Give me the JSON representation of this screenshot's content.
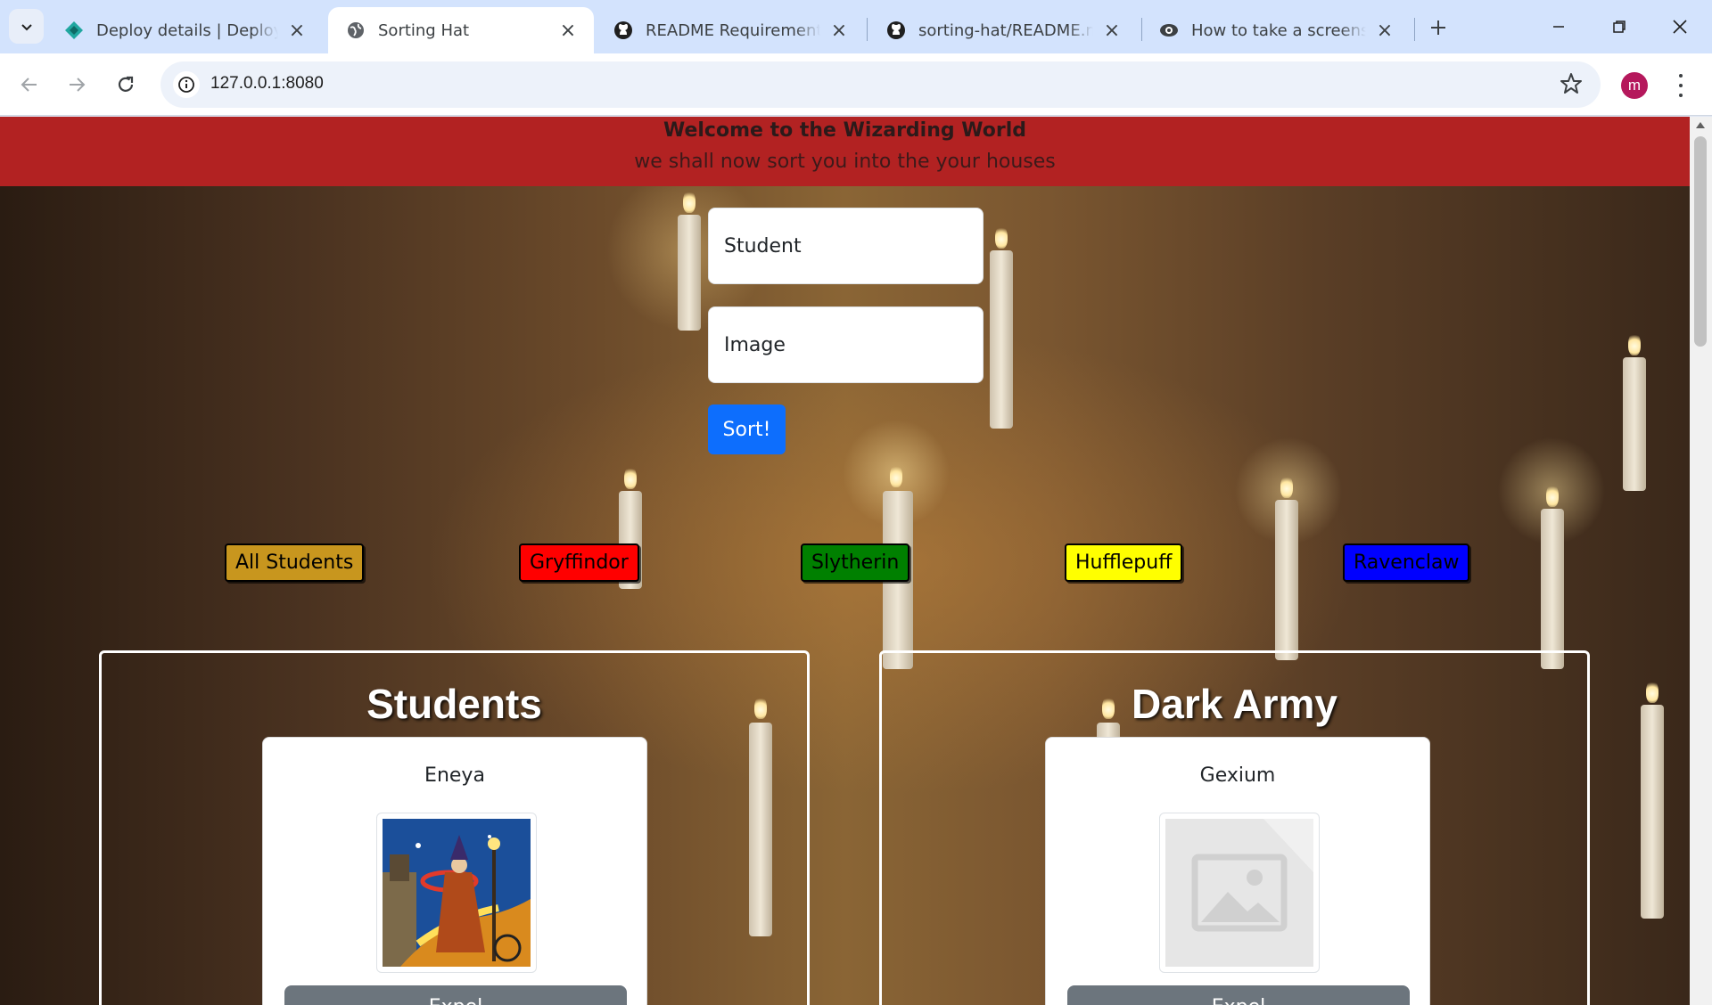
{
  "browser": {
    "tabs": [
      {
        "title": "Deploy details | Deploys |",
        "favicon": "netlify-icon"
      },
      {
        "title": "Sorting Hat",
        "favicon": "globe-icon",
        "active": true
      },
      {
        "title": "README Requirements ·",
        "favicon": "github-icon"
      },
      {
        "title": "sorting-hat/README.md",
        "favicon": "github-icon"
      },
      {
        "title": "How to take a screenshot",
        "favicon": "eye-icon"
      }
    ],
    "address": "127.0.0.1:8080",
    "profile_initial": "m"
  },
  "page": {
    "header_title": "Welcome to the Wizarding World",
    "header_subtitle": "we shall now sort you into the your houses",
    "form": {
      "student_placeholder": "Student",
      "image_placeholder": "Image",
      "sort_label": "Sort!"
    },
    "filters": [
      {
        "label": "All Students",
        "color": "#c8961e"
      },
      {
        "label": "Gryffindor",
        "color": "#ff0000"
      },
      {
        "label": "Slytherin",
        "color": "#008000"
      },
      {
        "label": "Hufflepuff",
        "color": "#ffff00"
      },
      {
        "label": "Ravenclaw",
        "color": "#0000ff"
      }
    ],
    "students_panel": {
      "title": "Students",
      "card": {
        "name": "Eneya",
        "image": "wizard-painting",
        "button_label": "Expel"
      }
    },
    "dark_army_panel": {
      "title": "Dark Army",
      "card": {
        "name": "Gexium",
        "image": "image-placeholder-icon",
        "button_label": "Expel"
      }
    }
  },
  "colors": {
    "header": "#b22222",
    "primary_button": "#0d6efd",
    "secondary_button": "#6c757d"
  }
}
